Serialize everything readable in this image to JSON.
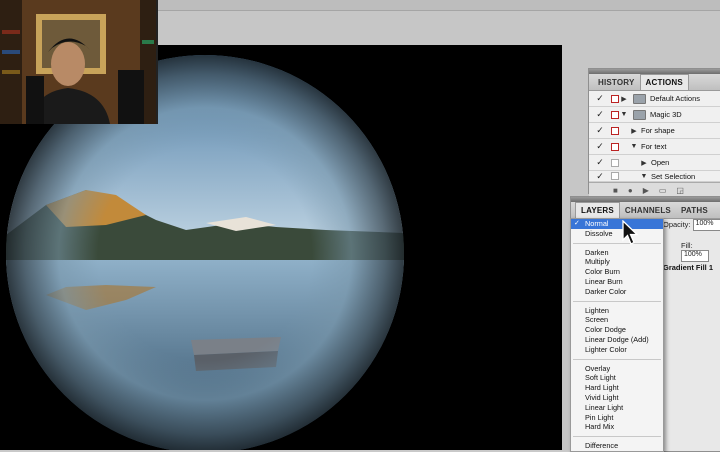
{
  "panels": {
    "actions_panel": {
      "tabs": [
        "HISTORY",
        "ACTIONS"
      ],
      "active_tab": "ACTIONS",
      "rows": [
        {
          "label": "Default Actions",
          "checked": true,
          "dialog": true,
          "expanded": false,
          "type": "set"
        },
        {
          "label": "Magic 3D",
          "checked": true,
          "dialog": true,
          "expanded": true,
          "type": "set"
        },
        {
          "label": "For shape",
          "checked": true,
          "dialog": true,
          "expanded": false,
          "type": "action"
        },
        {
          "label": "For text",
          "checked": true,
          "dialog": true,
          "expanded": true,
          "type": "action"
        },
        {
          "label": "Open",
          "checked": true,
          "dialog": false,
          "expanded": false,
          "type": "step"
        },
        {
          "label": "Set Selection",
          "checked": true,
          "dialog": false,
          "expanded": true,
          "type": "step"
        }
      ]
    },
    "layers_panel": {
      "tabs": [
        "LAYERS",
        "CHANNELS",
        "PATHS"
      ],
      "active_tab": "LAYERS",
      "opacity_label": "Opacity:",
      "opacity_value": "100%",
      "fill_label": "Fill:",
      "fill_value": "100%",
      "layer_name": "Gradient Fill 1"
    }
  },
  "blend_menu": {
    "selected": "Normal",
    "groups": [
      [
        "Normal",
        "Dissolve"
      ],
      [
        "Darken",
        "Multiply",
        "Color Burn",
        "Linear Burn",
        "Darker Color"
      ],
      [
        "Lighten",
        "Screen",
        "Color Dodge",
        "Linear Dodge (Add)",
        "Lighter Color"
      ],
      [
        "Overlay",
        "Soft Light",
        "Hard Light",
        "Vivid Light",
        "Linear Light",
        "Pin Light",
        "Hard Mix"
      ],
      [
        "Difference"
      ]
    ]
  },
  "icons": {
    "cursor": "arrow-cursor-icon",
    "visibility": "checkmark-icon",
    "dialog_toggle": "dialog-toggle-icon",
    "folder": "action-set-folder-icon"
  },
  "colors": {
    "menu_highlight": "#3875d7",
    "canvas_bg": "#000000",
    "panel_bg": "#e8e8e8"
  }
}
